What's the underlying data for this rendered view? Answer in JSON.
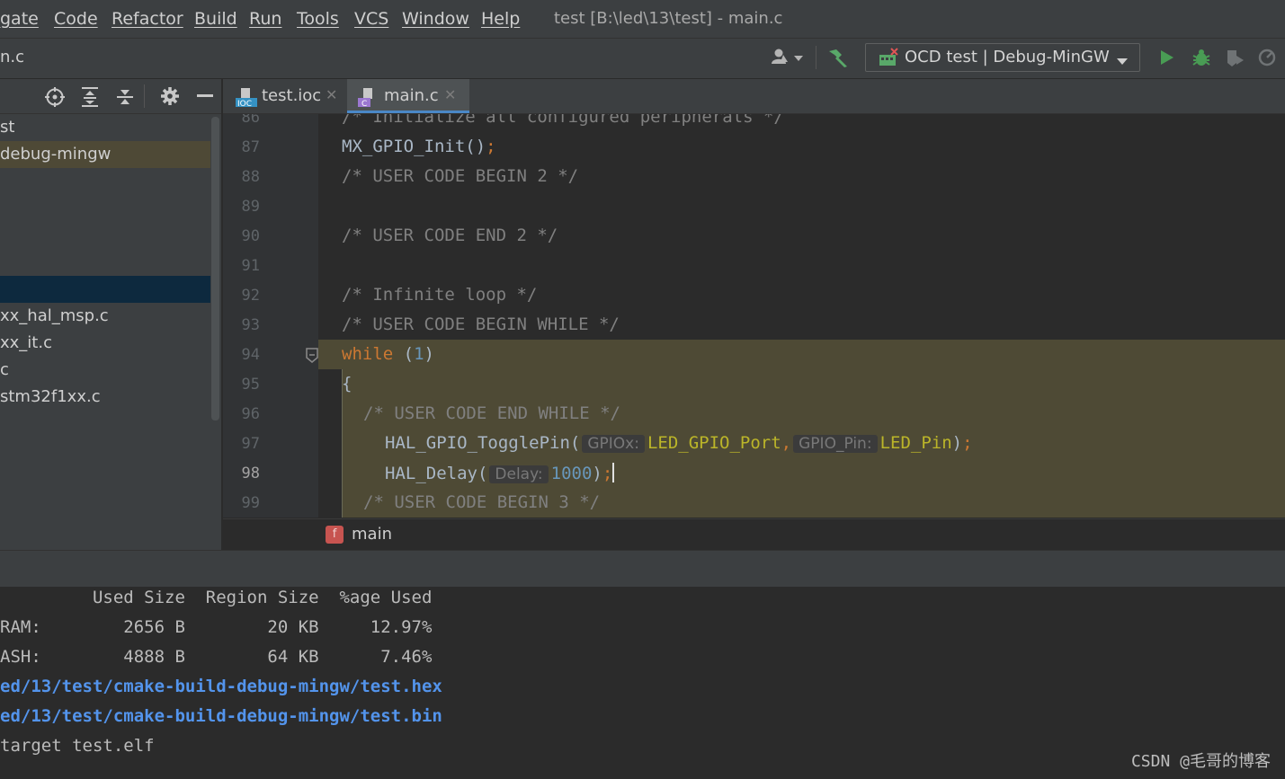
{
  "menu": [
    "gate",
    "Code",
    "Refactor",
    "Build",
    "Run",
    "Tools",
    "VCS",
    "Window",
    "Help"
  ],
  "window_title": "test [B:\\led\\13\\test] - main.c",
  "breadcrumb": "n.c",
  "run_config": "OCD test | Debug-MinGW",
  "project_tree": {
    "items": [
      "st",
      "debug-mingw",
      "",
      "",
      "xx_hal_msp.c",
      "xx_it.c",
      "c",
      "stm32f1xx.c"
    ]
  },
  "tabs": [
    {
      "label": "test.ioc",
      "icon": "ioc-file-icon",
      "active": false
    },
    {
      "label": "main.c",
      "icon": "c-file-icon",
      "active": true
    }
  ],
  "editor": {
    "line_numbers": [
      "86",
      "87",
      "88",
      "89",
      "90",
      "91",
      "92",
      "93",
      "94",
      "95",
      "96",
      "97",
      "98",
      "99"
    ],
    "lines": {
      "l86": "/* Initialize all configured peripherals */",
      "l87_call": "MX_GPIO_Init()",
      "l87_semi": ";",
      "l88": "/* USER CODE BEGIN 2 */",
      "l90": "/* USER CODE END 2 */",
      "l92": "/* Infinite loop */",
      "l93": "/* USER CODE BEGIN WHILE */",
      "l94_kw": "while",
      "l94_open": " (",
      "l94_num": "1",
      "l94_close": ")",
      "l95": "{",
      "l96": "/* USER CODE END WHILE */",
      "l97_fn": "HAL_GPIO_TogglePin(",
      "l97_hint1": "GPIOx:",
      "l97_arg1": "LED_GPIO_Port",
      "l97_comma": ",",
      "l97_hint2": "GPIO_Pin:",
      "l97_arg2": "LED_Pin",
      "l97_close": ")",
      "l97_semi": ";",
      "l98_fn": "HAL_Delay(",
      "l98_hint": "Delay:",
      "l98_num": "1000",
      "l98_close": ")",
      "l98_semi": ";",
      "l99": "/* USER CODE BEGIN 3 */"
    },
    "current_function": "main",
    "function_badge": "f"
  },
  "console": {
    "header": "         Used Size  Region Size  %age Used",
    "ram": "RAM:        2656 B        20 KB     12.97%",
    "flash": "ASH:        4888 B        64 KB      7.46%",
    "hex_path": "ed/13/test/cmake-build-debug-mingw/test.hex",
    "bin_path": "ed/13/test/cmake-build-debug-mingw/test.bin",
    "target": "target test.elf"
  },
  "watermark": "CSDN @毛哥的博客",
  "colors": {
    "keyword": "#cc7832",
    "number": "#6897bb",
    "comment": "#808080",
    "macro": "#bbb529",
    "link": "#5394ec",
    "highlight": "#4e4a35"
  }
}
